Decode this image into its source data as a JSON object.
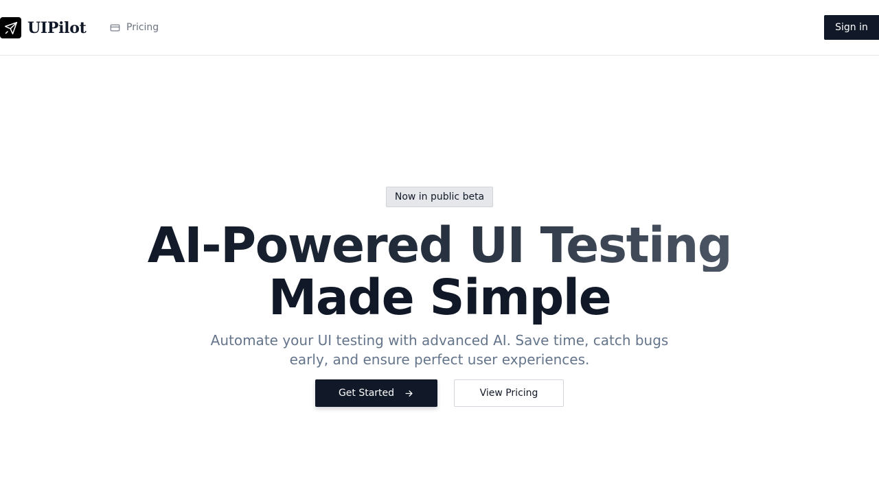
{
  "header": {
    "brand": {
      "name": "UIPilot",
      "icon": "paper-plane-icon"
    },
    "nav": [
      {
        "label": "Pricing",
        "icon": "credit-card-icon"
      }
    ],
    "signin_label": "Sign in"
  },
  "hero": {
    "badge": "Now in public beta",
    "headline_line1": "AI-Powered UI Testing",
    "headline_line2": "Made Simple",
    "subtitle": "Automate your UI testing with advanced AI. Save time, catch bugs early, and ensure perfect user experiences.",
    "primary_cta": {
      "label": "Get Started",
      "icon": "arrow-right-icon"
    },
    "secondary_cta": {
      "label": "View Pricing"
    }
  },
  "colors": {
    "primary": "#111827",
    "muted_text": "#6b7280",
    "subtitle_text": "#64748b",
    "badge_bg": "#e5e7eb",
    "border": "#e5e7eb"
  }
}
